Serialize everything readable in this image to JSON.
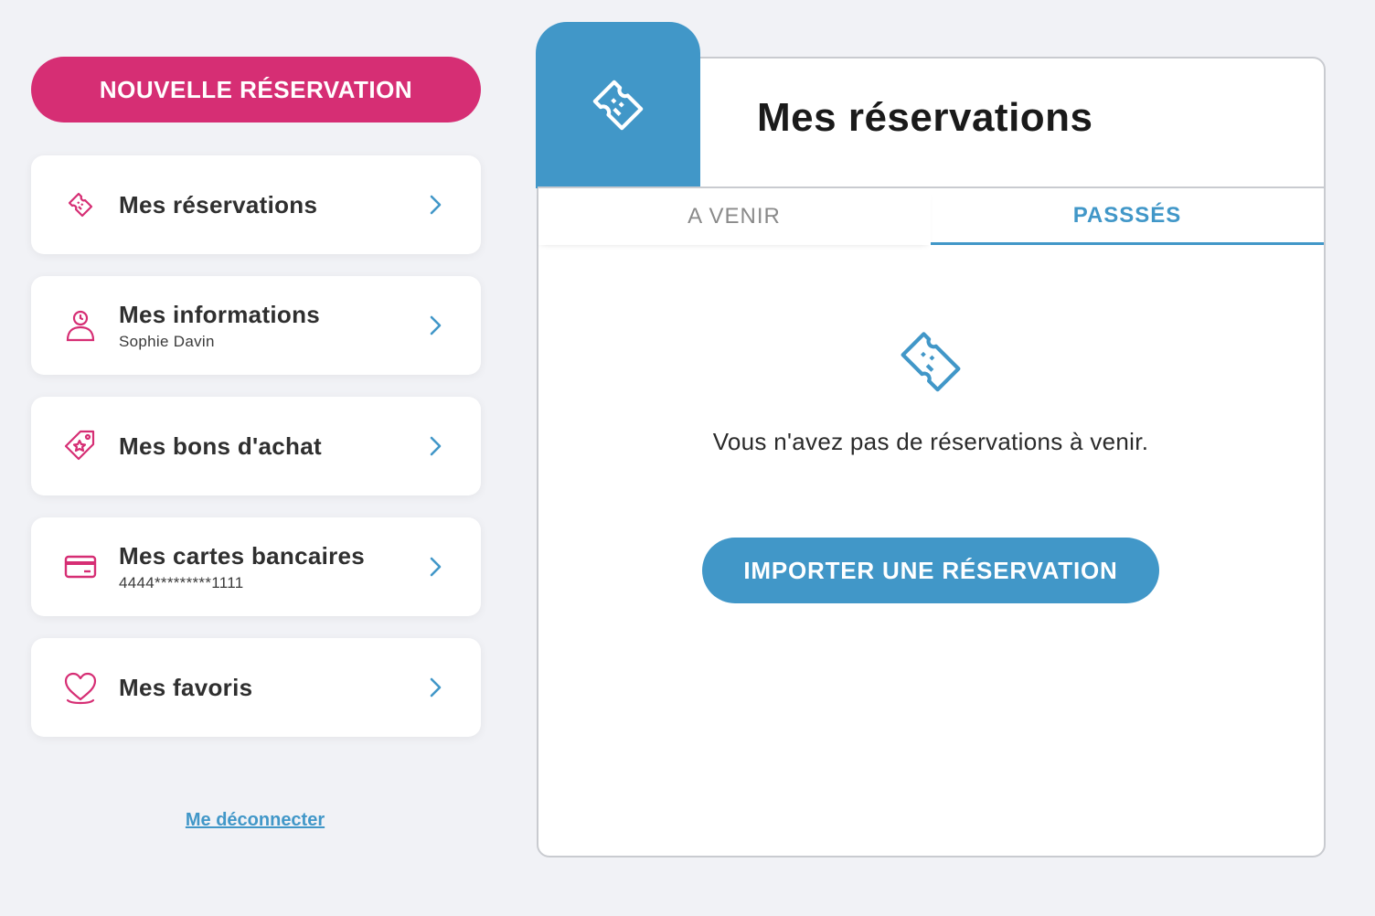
{
  "sidebar": {
    "new_reservation_label": "NOUVELLE RÉSERVATION",
    "items": [
      {
        "label": "Mes réservations",
        "sub": "",
        "icon": "ticket-icon"
      },
      {
        "label": "Mes informations",
        "sub": "Sophie Davin",
        "icon": "user-icon"
      },
      {
        "label": "Mes bons d'achat",
        "sub": "",
        "icon": "voucher-tag-icon"
      },
      {
        "label": "Mes cartes bancaires",
        "sub": "4444*********1111",
        "icon": "credit-card-icon"
      },
      {
        "label": "Mes favoris",
        "sub": "",
        "icon": "heart-icon"
      }
    ],
    "logout_label": "Me déconnecter"
  },
  "panel": {
    "title": "Mes réservations",
    "tabs": [
      {
        "label": "A VENIR",
        "active": false
      },
      {
        "label": "PASSSÉS",
        "active": true
      }
    ],
    "empty_message": "Vous n'avez pas de réservations à venir.",
    "import_label": "IMPORTER UNE RÉSERVATION"
  },
  "colors": {
    "accent_pink": "#d62e74",
    "accent_blue": "#4197c8",
    "background": "#f1f2f6"
  }
}
